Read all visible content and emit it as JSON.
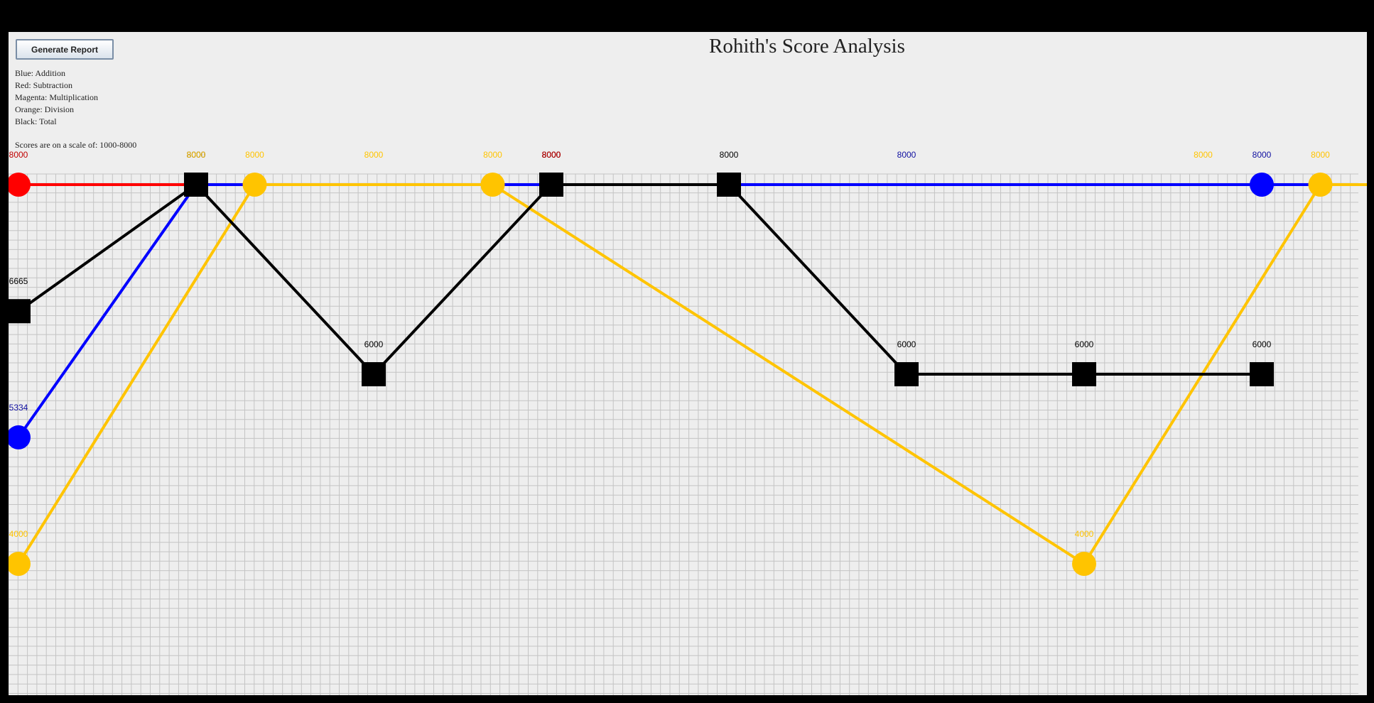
{
  "button": {
    "label": "Generate Report"
  },
  "title": "Rohith's Score Analysis",
  "legend": [
    "Blue: Addition",
    "Red: Subtraction",
    "Magenta: Multiplication",
    "Orange: Division",
    "Black: Total"
  ],
  "scale_note": "Scores are on a scale of: 1000-8000",
  "colors": {
    "addition": "#0000ff",
    "subtraction": "#ff0000",
    "division": "#ffc400",
    "total": "#000000",
    "grid": "#c4c4c4",
    "background": "#eeeeee"
  },
  "chart_data": {
    "type": "line",
    "grid": true,
    "ylim": [
      1000,
      8000
    ],
    "series": [
      {
        "name": "Subtraction",
        "key": "subtraction",
        "marker": "circle",
        "points": [
          [
            0,
            8000
          ],
          [
            3,
            8000
          ],
          [
            9,
            8000
          ]
        ]
      },
      {
        "name": "Addition",
        "key": "addition",
        "marker": "circle",
        "points": [
          [
            0,
            5334
          ],
          [
            1,
            8000
          ],
          [
            7,
            8000
          ],
          [
            10,
            8000
          ]
        ]
      },
      {
        "name": "Division",
        "key": "division",
        "marker": "circle",
        "points": [
          [
            0,
            4000
          ],
          [
            1.33,
            8000
          ],
          [
            2.67,
            8000
          ],
          [
            6,
            4000
          ],
          [
            7.33,
            8000
          ],
          [
            8.67,
            8000
          ]
        ]
      },
      {
        "name": "Total",
        "key": "total",
        "marker": "square",
        "points": [
          [
            0,
            6665
          ],
          [
            1,
            8000
          ],
          [
            2,
            6000
          ],
          [
            3,
            8000
          ],
          [
            4,
            8000
          ],
          [
            5,
            6000
          ],
          [
            6,
            6000
          ],
          [
            7,
            6000
          ]
        ]
      }
    ],
    "label_overrides": {
      "addition": [
        [
          5,
          8000
        ]
      ],
      "subtraction": [
        [
          3,
          8000
        ]
      ],
      "division": [
        [
          1,
          8000
        ],
        [
          2,
          8000
        ],
        [
          6.67,
          8000
        ]
      ]
    }
  }
}
